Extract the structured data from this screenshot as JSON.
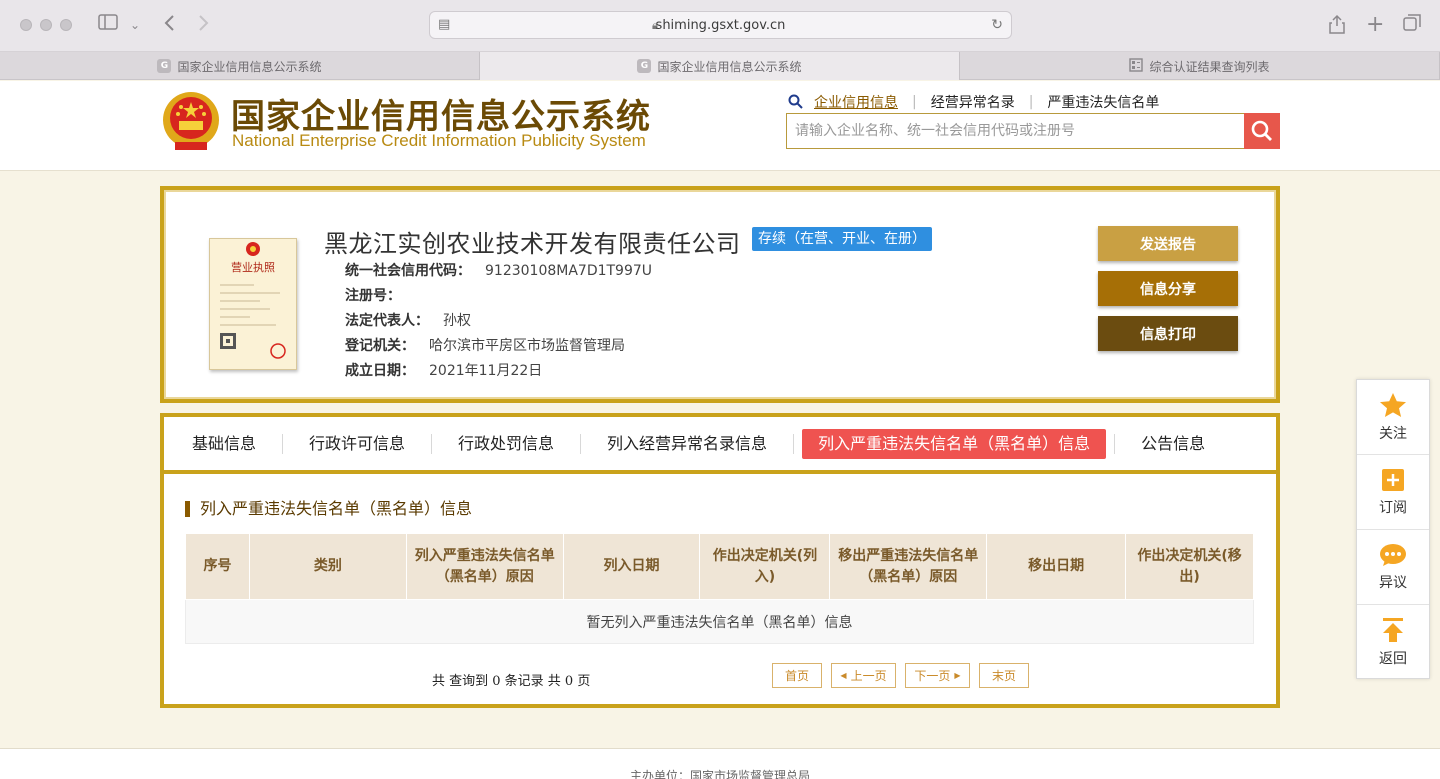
{
  "browser": {
    "url": "shiming.gsxt.gov.cn",
    "tabs": [
      {
        "label": "国家企业信用信息公示系统",
        "icon": "G"
      },
      {
        "label": "国家企业信用信息公示系统",
        "icon": "G"
      },
      {
        "label": "综合认证结果查询列表",
        "icon": "form-icon"
      }
    ]
  },
  "header": {
    "title": "国家企业信用信息公示系统",
    "subtitle": "National Enterprise Credit Information Publicity System",
    "nav": [
      "企业信用信息",
      "经营异常名录",
      "严重违法失信名单"
    ],
    "search_placeholder": "请输入企业名称、统一社会信用代码或注册号"
  },
  "company": {
    "name": "黑龙江实创农业技术开发有限责任公司",
    "status": "存续（在营、开业、在册）",
    "license_label": "营业执照",
    "fields": [
      {
        "label": "统一社会信用代码：",
        "value": "91230108MA7D1T997U"
      },
      {
        "label": "注册号：",
        "value": ""
      },
      {
        "label": "法定代表人：",
        "value": "孙权"
      },
      {
        "label": "登记机关：",
        "value": "哈尔滨市平房区市场监督管理局"
      },
      {
        "label": "成立日期：",
        "value": "2021年11月22日"
      }
    ],
    "actions": [
      "发送报告",
      "信息分享",
      "信息打印"
    ]
  },
  "tabs": [
    "基础信息",
    "行政许可信息",
    "行政处罚信息",
    "列入经营异常名录信息",
    "列入严重违法失信名单（黑名单）信息",
    "公告信息"
  ],
  "section": {
    "title": "列入严重违法失信名单（黑名单）信息",
    "columns": [
      "序号",
      "类别",
      "列入严重违法失信名单（黑名单）原因",
      "列入日期",
      "作出决定机关(列入)",
      "移出严重违法失信名单（黑名单）原因",
      "移出日期",
      "作出决定机关(移出)"
    ],
    "empty": "暂无列入严重违法失信名单（黑名单）信息",
    "pager_info": "共 查询到 0 条记录 共 0 页",
    "pager": [
      "首页",
      "上一页",
      "下一页",
      "末页"
    ]
  },
  "float_menu": [
    "关注",
    "订阅",
    "异议",
    "返回"
  ],
  "footer": "主办单位：国家市场监督管理总局",
  "colors": {
    "gold": "#c9a21b",
    "brown": "#8a5a00",
    "red": "#ef5350",
    "blue": "#2f8fe0"
  }
}
